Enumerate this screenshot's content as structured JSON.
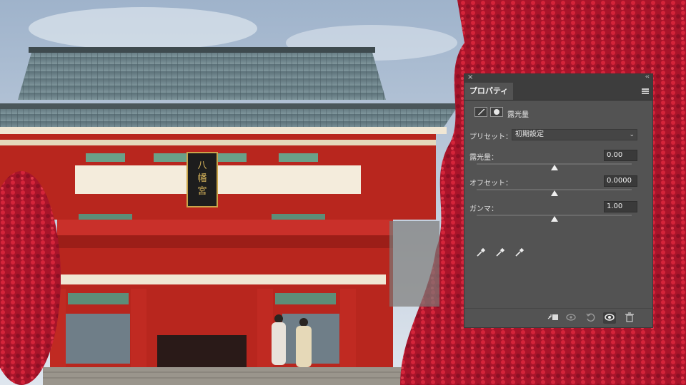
{
  "panel": {
    "title_tab": "プロパティ",
    "adjustment_title": "露光量",
    "preset_label": "プリセット：",
    "preset_value": "初期設定",
    "controls": [
      {
        "label": "露光量：",
        "value": "0.00",
        "slider_fraction": 0.5
      },
      {
        "label": "オフセット：",
        "value": "0.0000",
        "slider_fraction": 0.5
      },
      {
        "label": "ガンマ：",
        "value": "1.00",
        "slider_fraction": 0.5
      }
    ],
    "icons": {
      "close": "close-icon",
      "collapse": "collapse-double-chevron-icon",
      "menu": "panel-menu-icon",
      "exposure": "exposure-adjustment-icon",
      "mask": "layer-mask-icon",
      "eyedroppers": [
        "black-point-eyedropper-icon",
        "gray-point-eyedropper-icon",
        "white-point-eyedropper-icon"
      ],
      "bottom": [
        "clip-to-layer-icon",
        "view-previous-state-icon",
        "reset-icon",
        "visibility-eye-icon",
        "delete-icon"
      ]
    }
  },
  "colors": {
    "panel_bg": "#535353",
    "panel_dark": "#3d3d3d",
    "field_bg": "#3a3a3a",
    "foliage_red": "#c0182a"
  }
}
